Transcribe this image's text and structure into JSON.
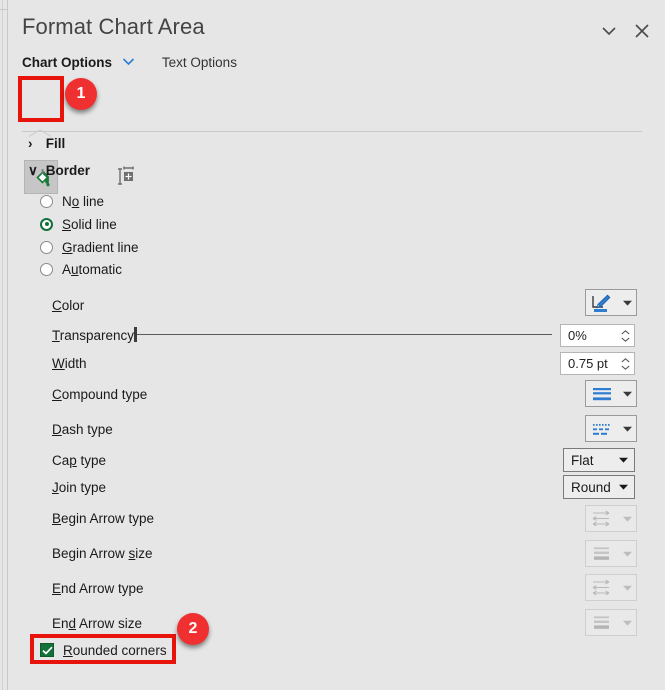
{
  "panel": {
    "title": "Format Chart Area",
    "collapse_icon": "chevron-down-icon",
    "close_icon": "close-icon"
  },
  "option_tabs": [
    {
      "label": "Chart Options",
      "active": true
    },
    {
      "label": "Text Options",
      "active": false
    }
  ],
  "icon_tabs": [
    {
      "name": "fill-and-line-icon",
      "selected": true
    },
    {
      "name": "size-and-properties-icon",
      "selected": false
    }
  ],
  "sections": [
    {
      "label": "Fill",
      "expanded": false,
      "caret": "›"
    },
    {
      "label": "Border",
      "expanded": true,
      "caret": "∨"
    }
  ],
  "border": {
    "radios": [
      {
        "label_pre": "N",
        "accel": "o",
        "label_post": " line",
        "selected": false
      },
      {
        "label_pre": "",
        "accel": "S",
        "label_post": "olid line",
        "selected": true
      },
      {
        "label_pre": "",
        "accel": "G",
        "label_post": "radient line",
        "selected": false
      },
      {
        "label_pre": "A",
        "accel": "u",
        "label_post": "tomatic",
        "selected": false
      }
    ],
    "rows": [
      {
        "label_pre": "",
        "accel": "C",
        "label_post": "olor",
        "control": "color-split-button",
        "value": "",
        "icon": "pen-color-icon",
        "accent": "#2d7dd2",
        "disabled": false
      },
      {
        "label_pre": "",
        "accel": "T",
        "label_post": "ransparency",
        "control": "slider-and-spinner",
        "value": "0%",
        "disabled": false
      },
      {
        "label_pre": "",
        "accel": "W",
        "label_post": "idth",
        "control": "spinner",
        "value": "0.75 pt",
        "disabled": false
      },
      {
        "label_pre": "",
        "accel": "C",
        "label_post": "ompound type",
        "control": "gallery-split-button",
        "value": "",
        "icon": "compound-line-icon",
        "accent": "#2d7dd2",
        "disabled": false
      },
      {
        "label_pre": "",
        "accel": "D",
        "label_post": "ash type",
        "control": "gallery-split-button",
        "value": "",
        "icon": "dash-line-icon",
        "accent": "#2d7dd2",
        "disabled": false
      },
      {
        "label_pre": "Ca",
        "accel": "p",
        "label_post": " type",
        "control": "dropdown",
        "value": "Flat",
        "disabled": false
      },
      {
        "label_pre": "",
        "accel": "J",
        "label_post": "oin type",
        "control": "dropdown",
        "value": "Round",
        "disabled": false
      },
      {
        "label_pre": "",
        "accel": "B",
        "label_post": "egin Arrow type",
        "control": "gallery-split-button",
        "value": "",
        "icon": "begin-arrow-type-icon",
        "disabled": true
      },
      {
        "label_pre": "Begin Arrow ",
        "accel": "s",
        "label_post": "ize",
        "control": "gallery-split-button",
        "value": "",
        "icon": "begin-arrow-size-icon",
        "disabled": true
      },
      {
        "label_pre": "",
        "accel": "E",
        "label_post": "nd Arrow type",
        "control": "gallery-split-button",
        "value": "",
        "icon": "end-arrow-type-icon",
        "disabled": true
      },
      {
        "label_pre": "En",
        "accel": "d",
        "label_post": " Arrow size",
        "control": "gallery-split-button",
        "value": "",
        "icon": "end-arrow-size-icon",
        "disabled": true
      }
    ],
    "transparency": {
      "value": "0%",
      "percent": 0
    },
    "rounded_corners": {
      "label_pre": "R",
      "accel": "",
      "label_post": "ounded corners",
      "accel_char": "R",
      "checked": true
    }
  },
  "callouts": [
    {
      "badge": "1",
      "target": "fill-and-line-icon"
    },
    {
      "badge": "2",
      "target": "rounded-corners-checkbox"
    }
  ],
  "colors": {
    "panel_bg": "#e6e6e6",
    "accent_green": "#12703a",
    "accent_blue": "#2d7dd2",
    "callout_red": "#e8140c",
    "badge_red": "#f03030"
  }
}
